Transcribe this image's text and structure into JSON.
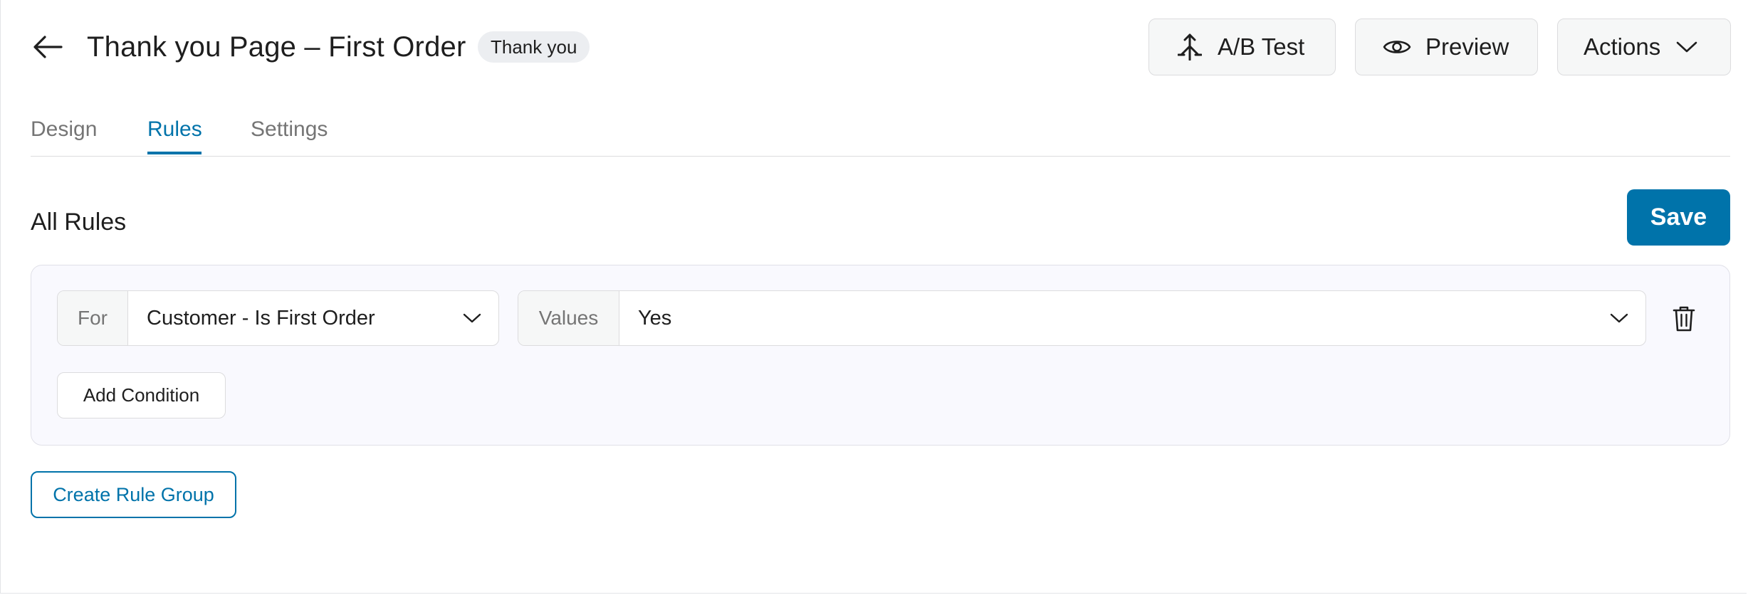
{
  "header": {
    "title": "Thank you Page – First Order",
    "badge": "Thank you",
    "ab_test_label": "A/B Test",
    "preview_label": "Preview",
    "actions_label": "Actions"
  },
  "tabs": [
    {
      "label": "Design",
      "active": false
    },
    {
      "label": "Rules",
      "active": true
    },
    {
      "label": "Settings",
      "active": false
    }
  ],
  "rules": {
    "heading": "All Rules",
    "save_label": "Save",
    "groups": [
      {
        "conditions": [
          {
            "for_label": "For",
            "for_value": "Customer - Is First Order",
            "values_label": "Values",
            "values_value": "Yes"
          }
        ],
        "add_condition_label": "Add Condition"
      }
    ],
    "create_group_label": "Create Rule Group"
  },
  "icons": {
    "back": "arrow-left-icon",
    "ab_test": "split-arrows-icon",
    "preview": "eye-icon",
    "actions": "chevron-down-icon",
    "delete": "trash-icon",
    "select_caret": "chevron-down-icon"
  },
  "colors": {
    "accent": "#0073aa",
    "panel_bg": "#f9f9fe",
    "badge_bg": "#eceef1",
    "muted_text": "#757575"
  }
}
